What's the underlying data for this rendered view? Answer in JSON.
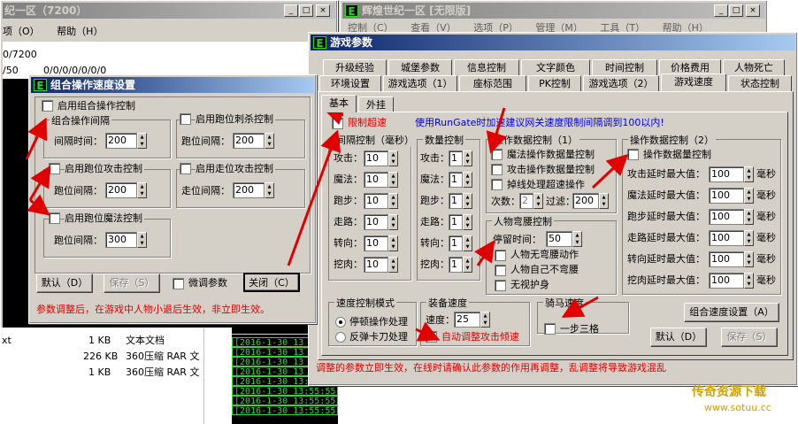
{
  "bgwin1": {
    "title": "纪一区（7200）",
    "menu": [
      "项（O）",
      "帮助（H）"
    ],
    "line1": "0/7200",
    "line2": "/50",
    "line3": "0/0/0/0/0/0/0"
  },
  "bgwin2": {
    "title": "辉煌世纪一区 [无限版]",
    "menu": [
      "控制（C）",
      "查看（V）",
      "选项（P）",
      "管理（M）",
      "工具（T）",
      "帮助（H）"
    ]
  },
  "files": [
    {
      "name": "xt",
      "size": "1 KB",
      "type": "文本文档"
    },
    {
      "name": "",
      "size": "226 KB",
      "type": "360压缩 RAR 文"
    },
    {
      "name": "",
      "size": "1 KB",
      "type": "360压缩 RAR 文"
    }
  ],
  "terminal": [
    "[2016-1-30 13",
    "[2016-1-30 13",
    "[2016-1-30 13",
    "[2016-1-30 13",
    "[2016-1-30 13:55:52",
    "[2016-1-30 13:55:55",
    "[2016-1-30 13:55:55",
    "[2016-1-30 13:55:55"
  ],
  "combo": {
    "title": "组合操作速度设置",
    "enable_group": "启用组合操作控制",
    "group_interval_title": "组合操作间隔",
    "interval_time_label": "间隔时间：",
    "interval_time_value": "200",
    "run_kill_check": "启用跑位刺杀控制",
    "run_interval_label": "跑位间隔：",
    "run_kill_value": "200",
    "run_attack_check": "启用跑位攻击控制",
    "run_attack_label": "跑位间隔：",
    "run_attack_value": "200",
    "walk_attack_check": "启用走位攻击控制",
    "walk_interval_label": "走位间隔：",
    "walk_attack_value": "200",
    "run_magic_check": "启用跑位魔法控制",
    "run_magic_label": "跑位间隔：",
    "run_magic_value": "300",
    "default_btn": "默认（D）",
    "save_btn": "保存（S）",
    "fine_tune": "微调参数",
    "close_btn": "关闭（C）",
    "note": "参数调整后，在游戏中人物小退后生效，非立即生效。"
  },
  "params": {
    "title": "游戏参数",
    "tabs_row1": [
      "升级经验",
      "城堡参数",
      "信息控制",
      "文字颜色",
      "时间控制",
      "价格费用",
      "人物死亡"
    ],
    "tabs_row2": [
      "环境设置",
      "游戏选项（1）",
      "座标范围",
      "PK控制",
      "游戏选项（2）",
      "游戏速度",
      "状态控制"
    ],
    "subtabs": [
      "基本",
      "外挂"
    ],
    "limit_speed": "限制超速",
    "hint": "使用RunGate时加速建议网关速度限制间隔调到100以内!",
    "interval_ctrl_title": "间隔控制（毫秒）",
    "interval_rows": [
      {
        "label": "攻击：",
        "value": "10"
      },
      {
        "label": "魔法：",
        "value": "10"
      },
      {
        "label": "跑步：",
        "value": "10"
      },
      {
        "label": "走路：",
        "value": "10"
      },
      {
        "label": "转向：",
        "value": "10"
      },
      {
        "label": "挖肉：",
        "value": "10"
      }
    ],
    "count_ctrl_title": "数量控制",
    "count_rows": [
      {
        "label": "攻击：",
        "value": "1"
      },
      {
        "label": "魔法：",
        "value": "1"
      },
      {
        "label": "跑步：",
        "value": "1"
      },
      {
        "label": "走路：",
        "value": "1"
      },
      {
        "label": "转向：",
        "value": "1"
      },
      {
        "label": "挖肉：",
        "value": "1"
      }
    ],
    "op_ctrl1_title": "操作数据控制（1）",
    "op1_checks": [
      "魔法操作数据量控制",
      "攻击操作数据量控制",
      "掉线处理超速操作"
    ],
    "count_label": "次数：",
    "count_value": "2",
    "filter_label": "过滤：",
    "filter_value": "200",
    "bow_title": "人物弯腰控制",
    "stay_label": "停留时间：",
    "stay_value": "50",
    "bow_checks": [
      "人物无弯腰动作",
      "人物自己不弯腰",
      "无视护身"
    ],
    "op_ctrl2_title": "操作数据控制（2）",
    "op_ctrl2_check": "操作数据量控制",
    "max_rows": [
      {
        "label": "攻击延时最大值：",
        "value": "100",
        "unit": "毫秒"
      },
      {
        "label": "魔法延时最大值：",
        "value": "100",
        "unit": "毫秒"
      },
      {
        "label": "跑步延时最大值：",
        "value": "100",
        "unit": "毫秒"
      },
      {
        "label": "走路延时最大值：",
        "value": "100",
        "unit": "毫秒"
      },
      {
        "label": "转向延时最大值：",
        "value": "100",
        "unit": "毫秒"
      },
      {
        "label": "挖肉延时最大值：",
        "value": "100",
        "unit": "毫秒"
      }
    ],
    "speed_mode_title": "速度控制模式",
    "mode_options": [
      "停顿操作处理",
      "反弹卡刀处理"
    ],
    "equip_title": "装备速度",
    "speed_label": "速度：",
    "speed_value": "25",
    "auto_adjust": "自动调整攻击倾速",
    "horse_title": "骑马速度",
    "one_step": "一步三格",
    "combo_btn": "组合速度设置（A）",
    "default_btn": "默认（D）",
    "save_btn": "保存（S）",
    "note": "调整的参数立即生效，在线时请确认此参数的作用再调整，乱调整将导致游戏混乱"
  },
  "watermark": {
    "line1": "传奇资源下载",
    "line2": "www.sotuu.cc"
  }
}
